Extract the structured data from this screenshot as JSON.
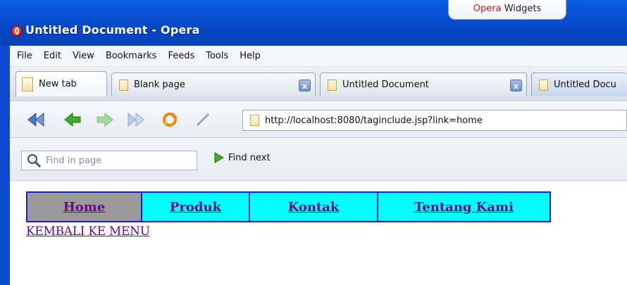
{
  "window": {
    "title": "Untitled Document - Opera",
    "widgets_brand": "Opera",
    "widgets_label": "Widgets"
  },
  "menubar": {
    "items": [
      "File",
      "Edit",
      "View",
      "Bookmarks",
      "Feeds",
      "Tools",
      "Help"
    ]
  },
  "tabs": [
    {
      "label": "New tab",
      "icon": "new-tab-icon"
    },
    {
      "label": "Blank page",
      "icon": "page-icon",
      "close": "x"
    },
    {
      "label": "Untitled Document",
      "icon": "page-icon",
      "close": "x"
    },
    {
      "label": "Untitled Docu",
      "icon": "page-icon",
      "selected": true
    }
  ],
  "toolbar": {
    "icons": [
      "rewind-icon",
      "back-icon",
      "forward-icon",
      "fast-forward-icon",
      "reload-icon",
      "wand-icon"
    ],
    "address": "http://localhost:8080/taginclude.jsp?link=home"
  },
  "findbar": {
    "placeholder": "Find in page",
    "next_label": "Find next"
  },
  "page": {
    "menu": [
      {
        "label": "Home",
        "active": true
      },
      {
        "label": "Produk",
        "active": false
      },
      {
        "label": "Kontak",
        "active": false
      },
      {
        "label": "Tentang Kami",
        "active": false
      }
    ],
    "back_link": "KEMBALI KE MENU"
  },
  "colors": {
    "titlebar": "#0a52d8",
    "menu_bg": "#00ffff",
    "menu_active_bg": "#9a9a9a",
    "menu_border": "#1b1bd6",
    "link": "#6a0a8c"
  }
}
